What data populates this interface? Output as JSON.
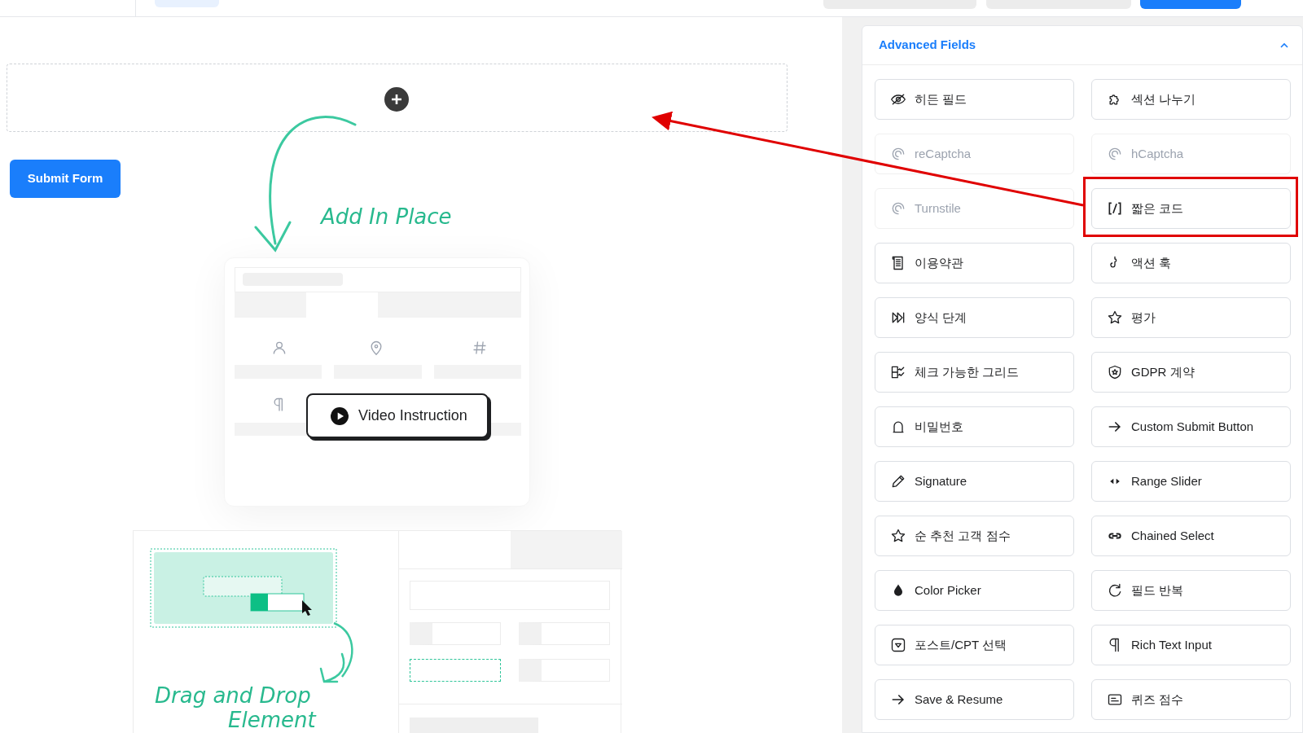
{
  "canvas": {
    "submit_button": "Submit Form",
    "add_in_place": "Add In Place",
    "video_button": "Video Instruction",
    "drag_drop_lines": [
      "Drag and Drop",
      "Element"
    ]
  },
  "panel": {
    "title": "Advanced Fields",
    "expanded": true,
    "fields": [
      {
        "label": "히든 필드",
        "disabled": false,
        "highlighted": false
      },
      {
        "label": "섹션 나누기",
        "disabled": false,
        "highlighted": false
      },
      {
        "label": "reCaptcha",
        "disabled": true,
        "highlighted": false
      },
      {
        "label": "hCaptcha",
        "disabled": true,
        "highlighted": false
      },
      {
        "label": "Turnstile",
        "disabled": true,
        "highlighted": false
      },
      {
        "label": "짧은 코드",
        "disabled": false,
        "highlighted": true
      },
      {
        "label": "이용약관",
        "disabled": false,
        "highlighted": false
      },
      {
        "label": "액션 훅",
        "disabled": false,
        "highlighted": false
      },
      {
        "label": "양식 단계",
        "disabled": false,
        "highlighted": false
      },
      {
        "label": "평가",
        "disabled": false,
        "highlighted": false
      },
      {
        "label": "체크 가능한 그리드",
        "disabled": false,
        "highlighted": false
      },
      {
        "label": "GDPR 계약",
        "disabled": false,
        "highlighted": false
      },
      {
        "label": "비밀번호",
        "disabled": false,
        "highlighted": false
      },
      {
        "label": "Custom Submit Button",
        "disabled": false,
        "highlighted": false
      },
      {
        "label": "Signature",
        "disabled": false,
        "highlighted": false
      },
      {
        "label": "Range Slider",
        "disabled": false,
        "highlighted": false
      },
      {
        "label": "순 추천 고객 점수",
        "disabled": false,
        "highlighted": false
      },
      {
        "label": "Chained Select",
        "disabled": false,
        "highlighted": false
      },
      {
        "label": "Color Picker",
        "disabled": false,
        "highlighted": false
      },
      {
        "label": "필드 반복",
        "disabled": false,
        "highlighted": false
      },
      {
        "label": "포스트/CPT 선택",
        "disabled": false,
        "highlighted": false
      },
      {
        "label": "Rich Text Input",
        "disabled": false,
        "highlighted": false
      },
      {
        "label": "Save & Resume",
        "disabled": false,
        "highlighted": false
      },
      {
        "label": "퀴즈 점수",
        "disabled": false,
        "highlighted": false
      }
    ]
  }
}
